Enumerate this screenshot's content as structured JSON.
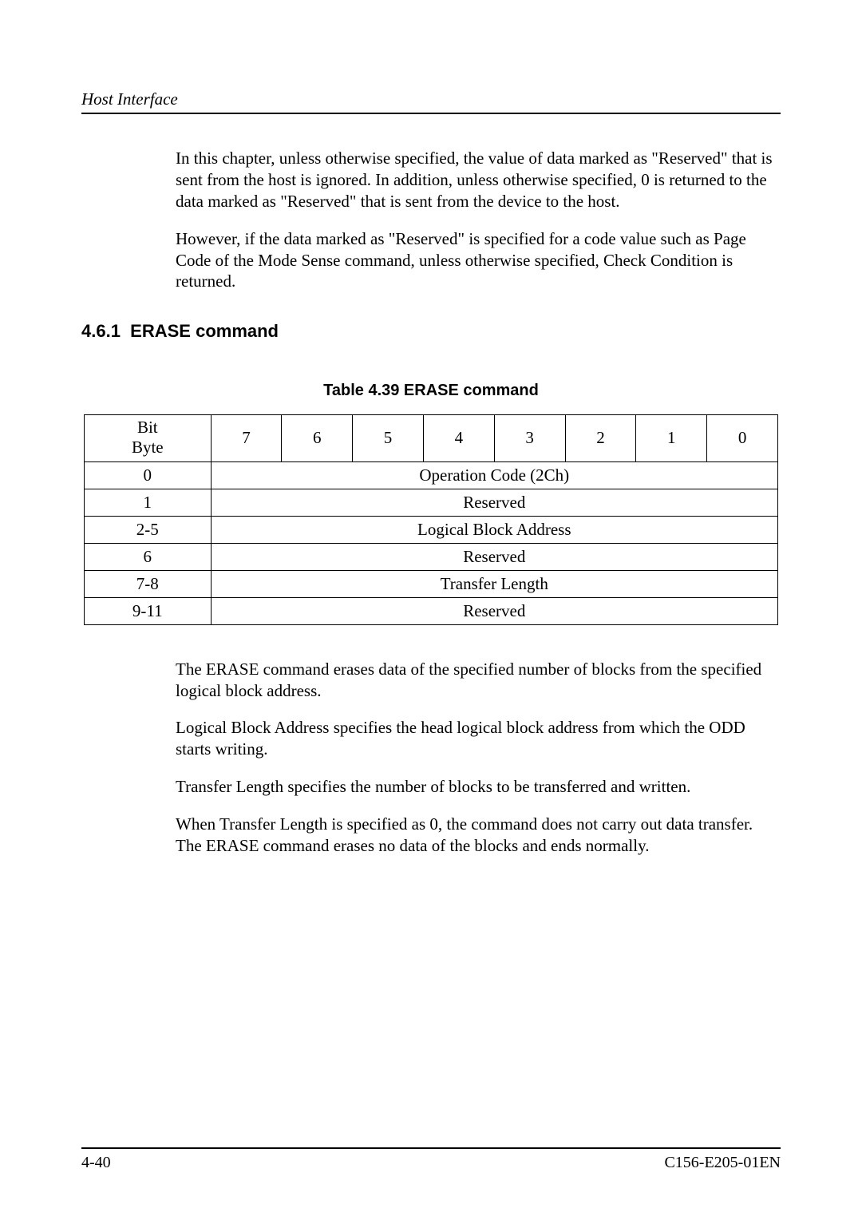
{
  "header": {
    "running": "Host Interface"
  },
  "intro": {
    "p1": "In this chapter, unless otherwise specified, the value of data marked as \"Reserved\" that is sent from the host is ignored.  In addition, unless otherwise specified, 0 is returned to the data marked as \"Reserved\" that is sent from the device to the host.",
    "p2": "However, if the data marked as \"Reserved\" is specified for a code value such as Page Code of the Mode Sense command, unless otherwise specified, Check Condition is returned."
  },
  "section": {
    "number": "4.6.1",
    "title": "ERASE command"
  },
  "table": {
    "caption": "Table 4.39 ERASE command",
    "header_label_line1": "Bit",
    "header_label_line2": "Byte",
    "bits": [
      "7",
      "6",
      "5",
      "4",
      "3",
      "2",
      "1",
      "0"
    ],
    "rows": [
      {
        "byte": "0",
        "desc": "Operation Code (2Ch)"
      },
      {
        "byte": "1",
        "desc": "Reserved"
      },
      {
        "byte": "2-5",
        "desc": "Logical Block Address"
      },
      {
        "byte": "6",
        "desc": "Reserved"
      },
      {
        "byte": "7-8",
        "desc": "Transfer Length"
      },
      {
        "byte": "9-11",
        "desc": "Reserved"
      }
    ]
  },
  "body": {
    "p1": "The ERASE command erases data of the specified number of blocks from the specified logical block address.",
    "p2": "Logical Block Address specifies the head logical block address from which the ODD starts writing.",
    "p3": "Transfer Length specifies the number of blocks to be transferred and written.",
    "p4": "When Transfer Length is specified as 0, the command does not carry out data transfer.  The ERASE command  erases no data of the blocks and ends normally."
  },
  "footer": {
    "page": "4-40",
    "docid": "C156-E205-01EN"
  }
}
